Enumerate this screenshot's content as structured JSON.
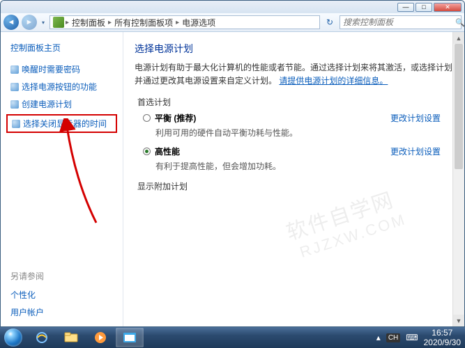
{
  "window": {
    "min": "—",
    "max": "□",
    "close": "✕"
  },
  "nav": {
    "back": "◄",
    "fwd": "►",
    "dd": "▾",
    "sep": "▸",
    "refresh": "↻"
  },
  "breadcrumb": [
    "控制面板",
    "所有控制面板项",
    "电源选项"
  ],
  "search": {
    "placeholder": "搜索控制面板",
    "icon": "🔍"
  },
  "sidebar": {
    "home": "控制面板主页",
    "links": [
      "唤醒时需要密码",
      "选择电源按钮的功能",
      "创建电源计划",
      "选择关闭显示器的时间"
    ],
    "seealso": "另请参阅",
    "extras": [
      "个性化",
      "用户帐户"
    ]
  },
  "main": {
    "title": "选择电源计划",
    "desc1": "电源计划有助于最大化计算机的性能或者节能。通过选择计划来将其激活，或选择计划并通过更改其电源设置来自定义计划。",
    "morelink": "请提供电源计划的详细信息。",
    "section1": "首选计划",
    "plans": [
      {
        "name": "平衡 (推荐)",
        "desc": "利用可用的硬件自动平衡功耗与性能。",
        "checked": false,
        "change": "更改计划设置"
      },
      {
        "name": "高性能",
        "desc": "有利于提高性能，但会增加功耗。",
        "checked": true,
        "change": "更改计划设置"
      }
    ],
    "section2": "显示附加计划"
  },
  "watermark": {
    "a": "软件自学网",
    "b": "RJZXW.COM"
  },
  "taskbar": {
    "ime": "CH",
    "time": "16:57",
    "date": "2020/9/30",
    "tray_up": "▴"
  }
}
